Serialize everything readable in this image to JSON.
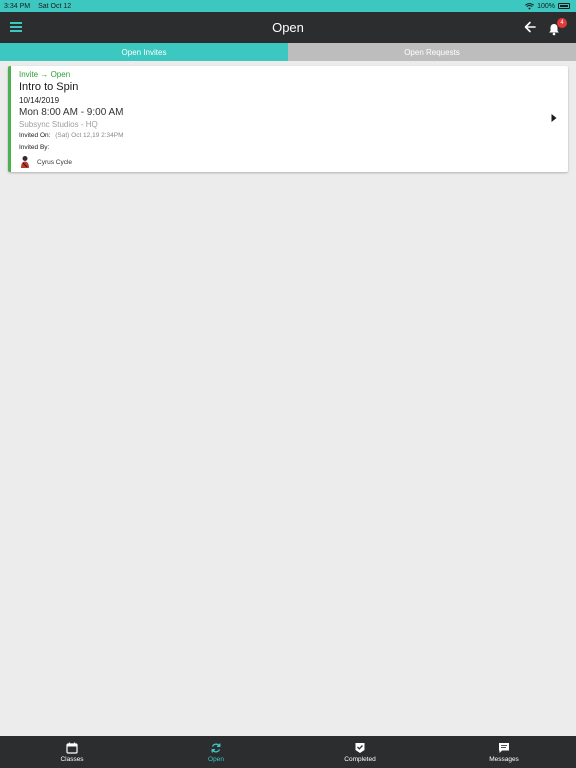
{
  "status_bar": {
    "time": "3:34 PM",
    "date": "Sat Oct 12",
    "battery": "100%"
  },
  "header": {
    "title": "Open",
    "notification_count": "4"
  },
  "tabs": [
    {
      "label": "Open Invites",
      "active": true
    },
    {
      "label": "Open Requests",
      "active": false
    }
  ],
  "card": {
    "status": "Invite → Open",
    "title": "Intro to Spin",
    "date": "10/14/2019",
    "time": "Mon 8:00 AM - 9:00 AM",
    "location": "Subsync Studios - HQ",
    "invited_on_label": "Invited On:",
    "invited_on_value": "(Sat) Oct 12,19 2:34PM",
    "invited_by_label": "Invited By:",
    "inviter_name": "Cyrus Cycle"
  },
  "bottom_nav": [
    {
      "label": "Classes",
      "icon": "calendar-icon"
    },
    {
      "label": "Open",
      "icon": "refresh-icon",
      "active": true
    },
    {
      "label": "Completed",
      "icon": "checkmark-badge-icon"
    },
    {
      "label": "Messages",
      "icon": "chat-icon"
    }
  ],
  "colors": {
    "accent": "#3cc8c0",
    "header_bg": "#2b2d2e",
    "status_green": "#2e9f3a",
    "badge_red": "#e53935",
    "tab_inactive": "#bdbdbd",
    "page_bg": "#ececec"
  }
}
